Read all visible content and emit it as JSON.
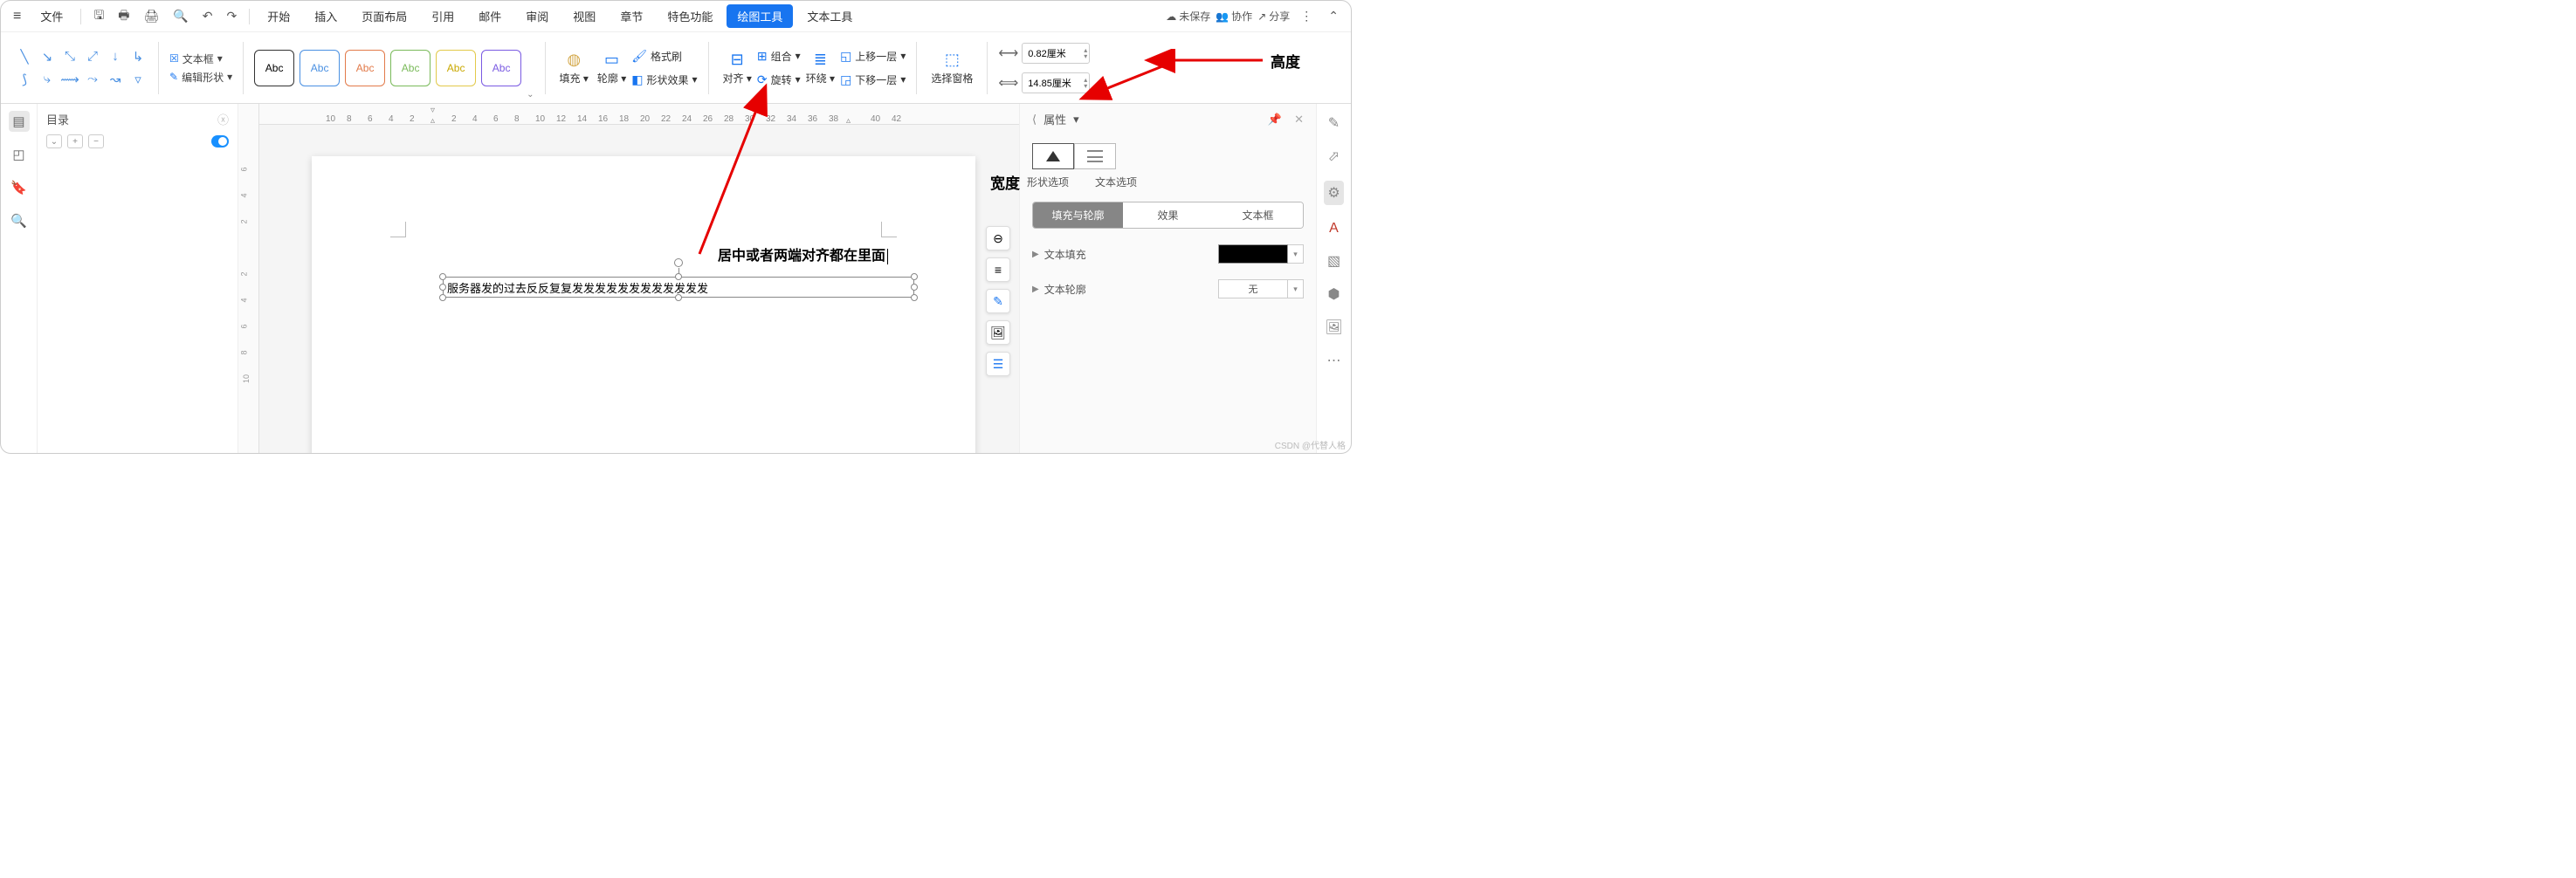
{
  "menubar": {
    "file": "文件",
    "tabs": [
      "开始",
      "插入",
      "页面布局",
      "引用",
      "邮件",
      "审阅",
      "视图",
      "章节",
      "特色功能",
      "绘图工具",
      "文本工具"
    ],
    "activeTab": "绘图工具",
    "unsaved": "未保存",
    "collab": "协作",
    "share": "分享"
  },
  "ribbon": {
    "textbox": "文本框",
    "editShape": "编辑形状",
    "abc": "Abc",
    "fill": "填充",
    "outline": "轮廓",
    "formatPainter": "格式刷",
    "shapeEffect": "形状效果",
    "align": "对齐",
    "group": "组合",
    "rotate": "旋转",
    "wrap": "环绕",
    "bringForward": "上移一层",
    "sendBackward": "下移一层",
    "selectPane": "选择窗格",
    "height": "0.82厘米",
    "width": "14.85厘米"
  },
  "abcColors": [
    "#333333",
    "#4a90e2",
    "#e27a4a",
    "#7aba5a",
    "#e2c94a",
    "#7a5ae2"
  ],
  "toc": {
    "title": "目录"
  },
  "ruler": {
    "ticks": [
      "10",
      "8",
      "6",
      "4",
      "2",
      "",
      "2",
      "4",
      "6",
      "8",
      "10",
      "12",
      "14",
      "16",
      "18",
      "20",
      "22",
      "24",
      "26",
      "28",
      "30",
      "32",
      "34",
      "36",
      "38",
      "40",
      "42"
    ]
  },
  "vruler": {
    "ticks": [
      "6",
      "4",
      "2",
      "",
      "2",
      "4",
      "6",
      "8",
      "10"
    ]
  },
  "page": {
    "annotation": "居中或者两端对齐都在里面",
    "textboxContent": "服务器发的过去反反复复发发发发发发发发发发发发"
  },
  "props": {
    "title": "属性",
    "shapeOptions": "形状选项",
    "textOptions": "文本选项",
    "segTabs": [
      "填充与轮廓",
      "效果",
      "文本框"
    ],
    "textFill": "文本填充",
    "textOutline": "文本轮廓",
    "none": "无"
  },
  "annotations": {
    "heightLabel": "高度",
    "widthLabel": "宽度"
  },
  "watermark": "CSDN @代替人格"
}
